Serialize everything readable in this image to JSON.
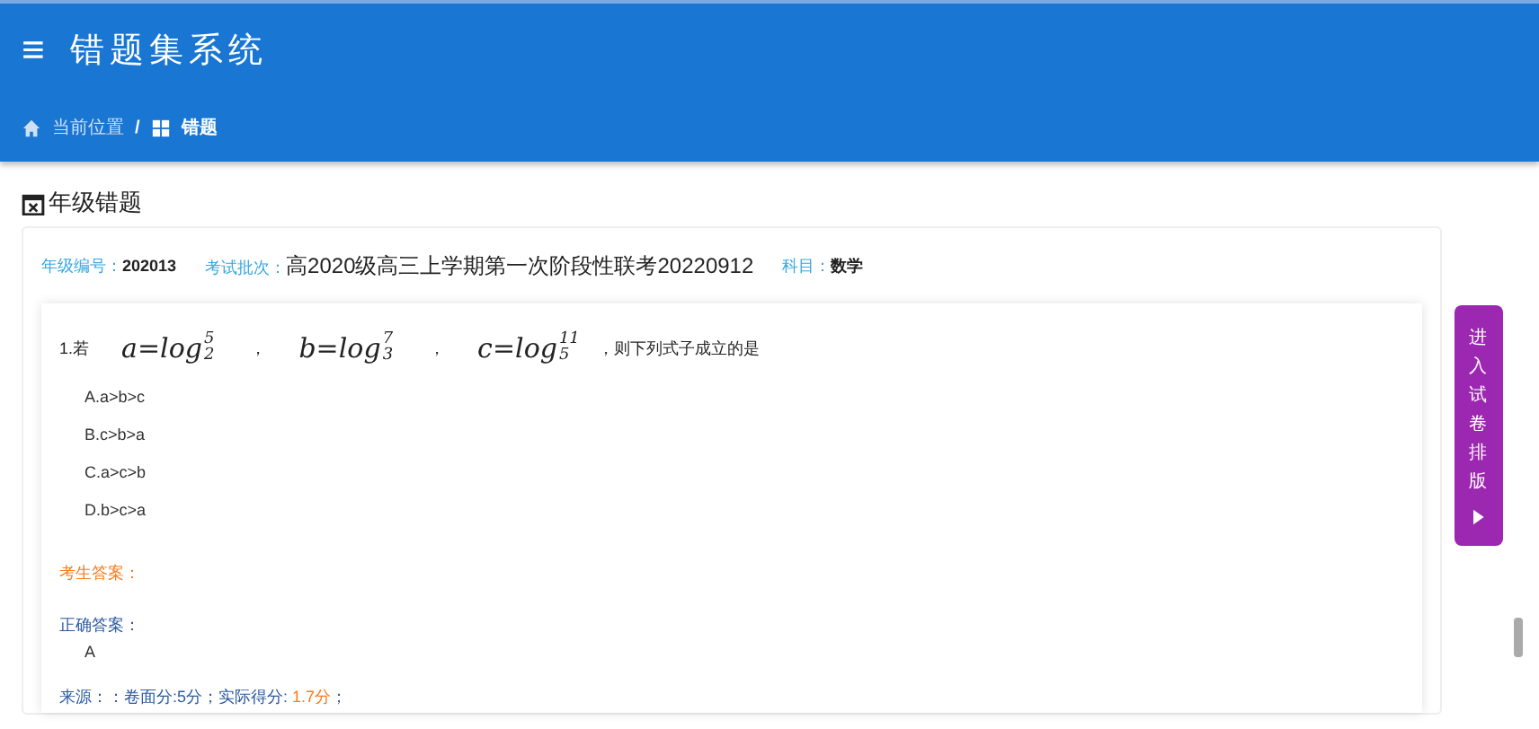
{
  "header": {
    "title": "错题集系统",
    "menu_icon": "≡"
  },
  "breadcrumb": [
    {
      "label": "当前位置"
    },
    {
      "label": "错题"
    }
  ],
  "breadcrumb_separator": "/",
  "section": {
    "title": "年级错题"
  },
  "info": [
    {
      "label": "年级编号：",
      "value": "202013"
    },
    {
      "label": "考试批次：",
      "value": "高2020级高三上学期第一次阶段性联考20220912"
    },
    {
      "label": "科目：",
      "value": "数学"
    }
  ],
  "question": {
    "prefix": "1.若",
    "formulas": [
      {
        "lhs": "a=log",
        "sub": "2",
        "sup": "5"
      },
      {
        "lhs": "b=log",
        "sub": "3",
        "sup": "7"
      },
      {
        "lhs": "c=log",
        "sub": "5",
        "sup": "11"
      }
    ],
    "separator": "，",
    "suffix": "，则下列式子成立的是",
    "options": [
      "A.a>b>c",
      "B.c>b>a",
      "C.a>c>b",
      "D.b>c>a"
    ],
    "student_answer_label": "考生答案：",
    "correct_answer_label": "正确答案：",
    "correct_answer": "A",
    "score_parts": [
      "来源：：卷面分:5分；实际得分: ",
      "1.7分",
      "；"
    ]
  },
  "side_button": {
    "label": "进入试卷排版"
  }
}
